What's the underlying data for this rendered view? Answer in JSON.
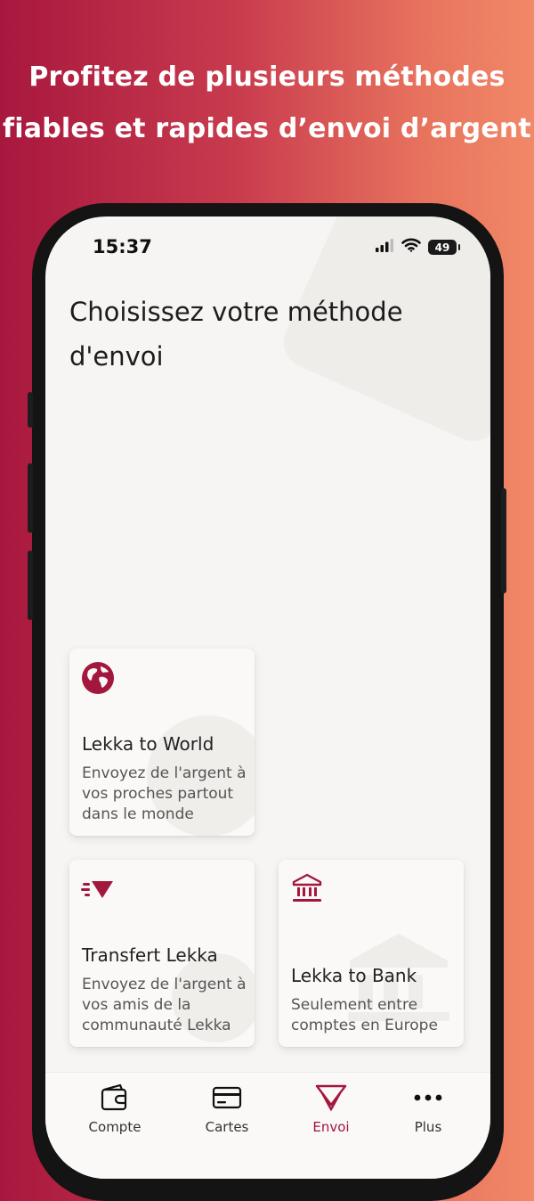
{
  "promo": {
    "headline_line1": "Profitez de plusieurs méthodes",
    "headline_line2": "fiables et rapides d’envoi d’argent"
  },
  "status_bar": {
    "time": "15:37",
    "battery": "49"
  },
  "page": {
    "title": "Choisissez votre méthode d'envoi"
  },
  "methods": [
    {
      "title": "Lekka to World",
      "description": "Envoyez de l'argent à vos proches partout dans le monde",
      "icon": "globe-icon"
    },
    {
      "title": "Transfert Lekka",
      "description": "Envoyez de l'argent à vos amis de la communauté Lekka",
      "icon": "fast-transfer-icon"
    },
    {
      "title": "Lekka to Bank",
      "description": "Seulement entre comptes en Europe",
      "icon": "bank-icon"
    }
  ],
  "tabs": [
    {
      "label": "Compte",
      "icon": "wallet-icon"
    },
    {
      "label": "Cartes",
      "icon": "card-icon"
    },
    {
      "label": "Envoi",
      "icon": "send-icon",
      "active": true
    },
    {
      "label": "Plus",
      "icon": "more-icon"
    }
  ],
  "colors": {
    "brand": "#a3173d",
    "gradient_start": "#a8173e",
    "gradient_end": "#f18868"
  }
}
